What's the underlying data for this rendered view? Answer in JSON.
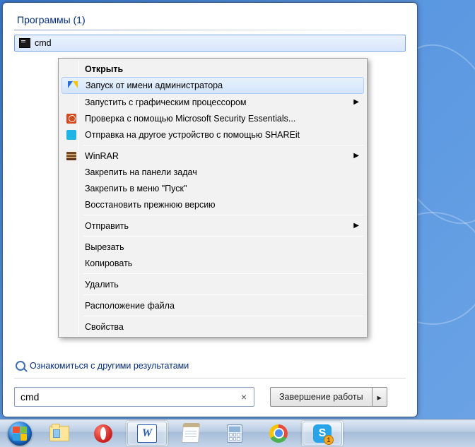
{
  "start_menu": {
    "programs_header": "Программы (1)",
    "result_label": "cmd",
    "see_more": "Ознакомиться с другими результатами",
    "search_value": "cmd",
    "shutdown_label": "Завершение работы"
  },
  "context_menu": {
    "items": [
      {
        "label": "Открыть",
        "bold": true
      },
      {
        "label": "Запуск от имени администратора",
        "icon": "shield",
        "highlight": true
      },
      {
        "label": "Запустить с графическим процессором",
        "submenu": true
      },
      {
        "label": "Проверка с помощью Microsoft Security Essentials...",
        "icon": "mse"
      },
      {
        "label": "Отправка на другое устройство с помощью SHAREit",
        "icon": "shareit"
      },
      {
        "sep": true
      },
      {
        "label": "WinRAR",
        "icon": "winrar",
        "submenu": true
      },
      {
        "label": "Закрепить на панели задач"
      },
      {
        "label": "Закрепить в меню \"Пуск\""
      },
      {
        "label": "Восстановить прежнюю версию"
      },
      {
        "sep": true
      },
      {
        "label": "Отправить",
        "submenu": true
      },
      {
        "sep": true
      },
      {
        "label": "Вырезать"
      },
      {
        "label": "Копировать"
      },
      {
        "sep": true
      },
      {
        "label": "Удалить"
      },
      {
        "sep": true
      },
      {
        "label": "Расположение файла"
      },
      {
        "sep": true
      },
      {
        "label": "Свойства"
      }
    ]
  },
  "taskbar": {
    "items": [
      {
        "name": "explorer",
        "active": false
      },
      {
        "name": "opera",
        "active": false
      },
      {
        "name": "word",
        "active": true,
        "letter": "W"
      },
      {
        "name": "notepad",
        "active": false
      },
      {
        "name": "calc",
        "active": false
      },
      {
        "name": "chrome",
        "active": false
      },
      {
        "name": "skype",
        "active": true,
        "letter": "S",
        "badge": "1"
      }
    ]
  }
}
